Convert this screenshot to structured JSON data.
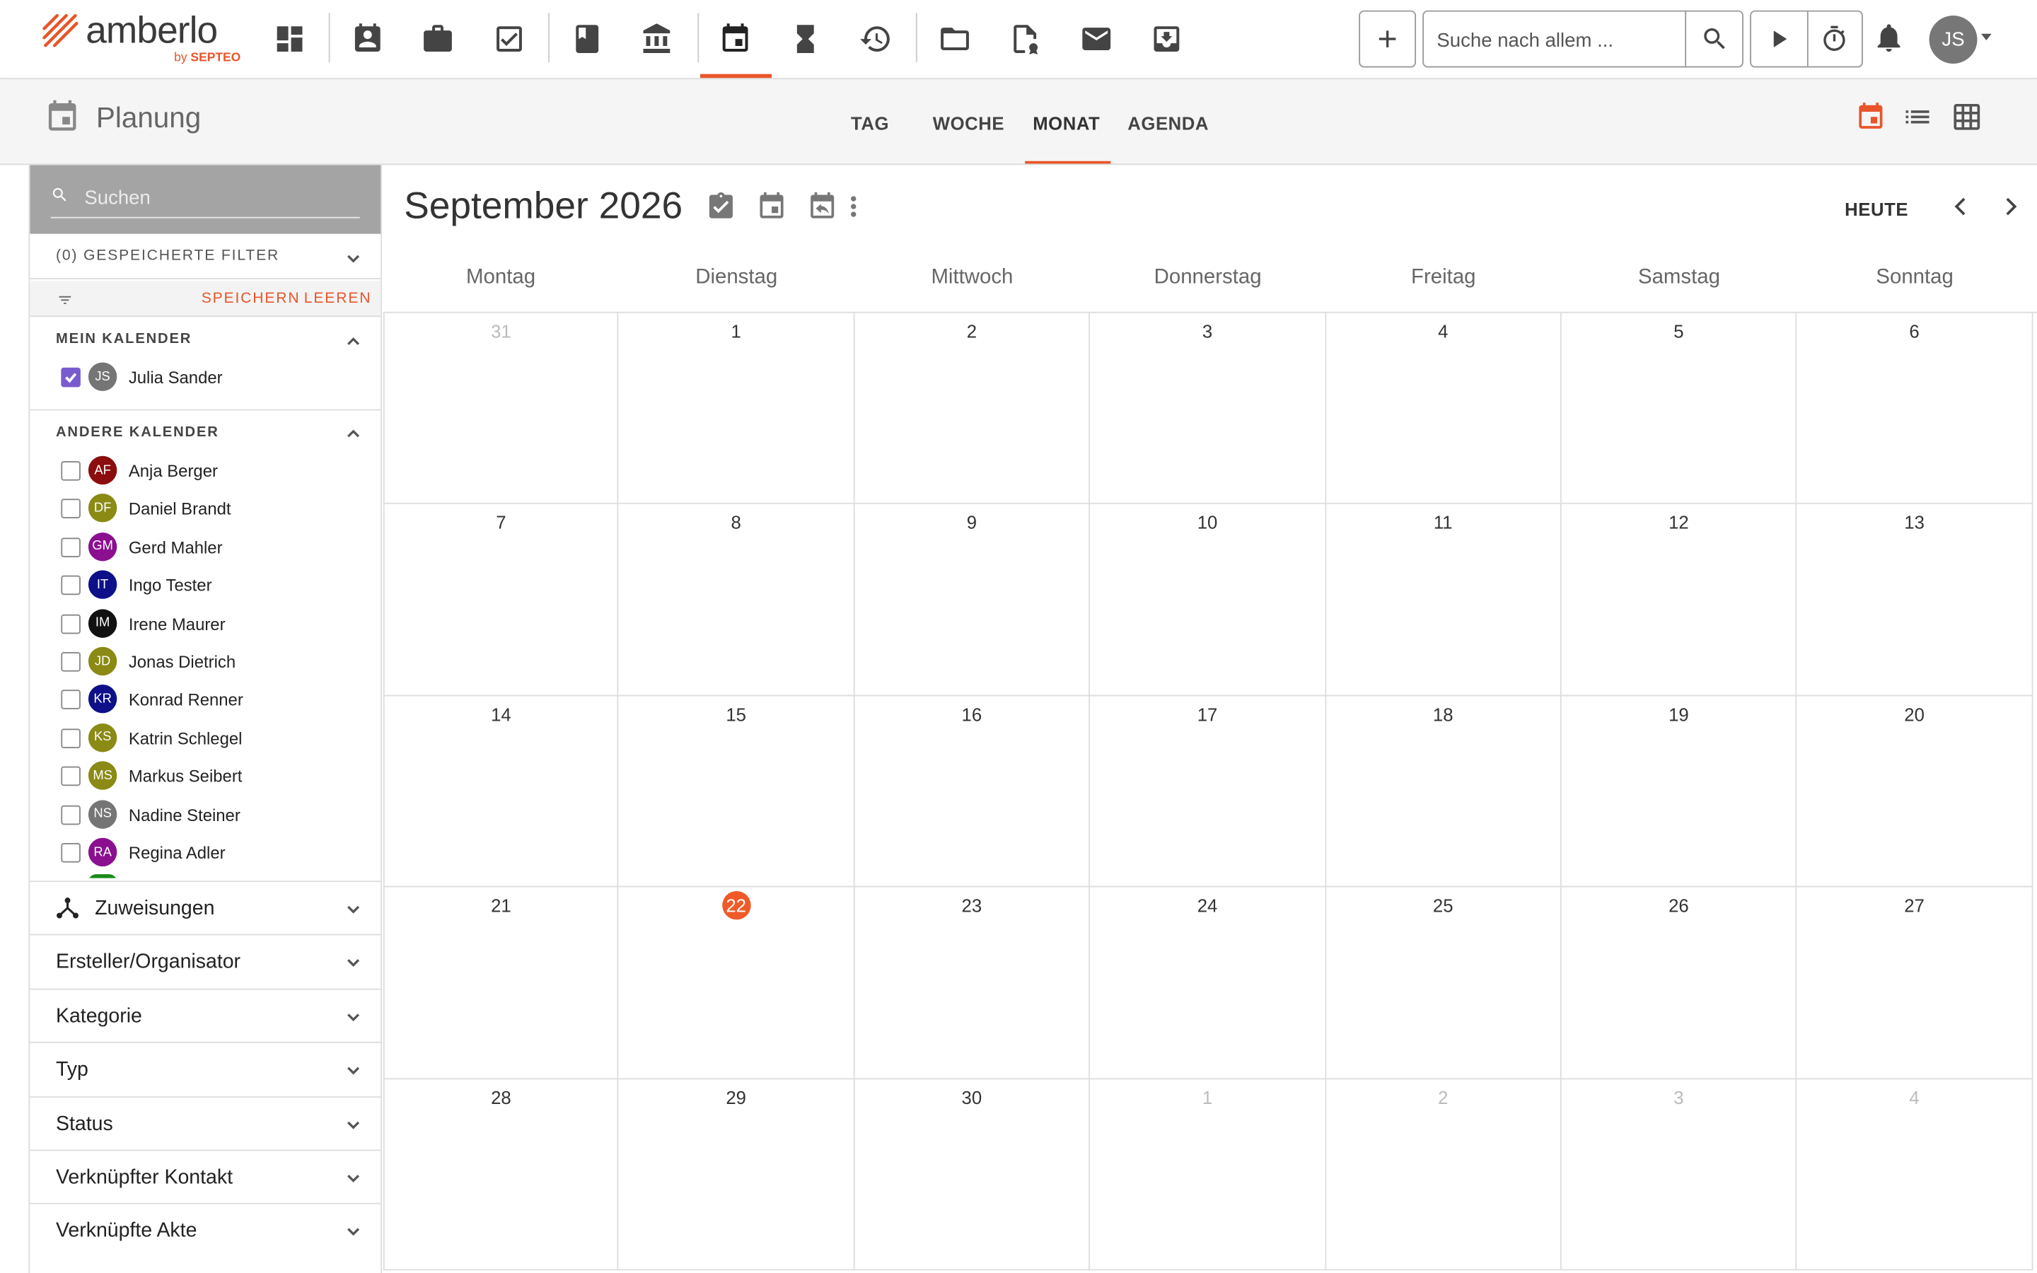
{
  "brand": {
    "name": "amberlo",
    "by_prefix": "by",
    "by_company": "SEPTEO"
  },
  "topnav": {
    "icons": [
      "dashboard-icon",
      "contacts-icon",
      "briefcase-icon",
      "tasks-icon",
      "book-icon",
      "bank-icon",
      "calendar-icon",
      "hourglass-icon",
      "billing-icon",
      "folder-icon",
      "certificate-icon",
      "mail-icon",
      "inbox-icon"
    ],
    "active": "calendar-icon",
    "search_placeholder": "Suche nach allem ...",
    "user_initials": "JS"
  },
  "page": {
    "title": "Planung",
    "view_tabs": [
      "TAG",
      "WOCHE",
      "MONAT",
      "AGENDA"
    ],
    "active_tab": "MONAT",
    "accent_color": "#e8552a"
  },
  "sidebar": {
    "search_placeholder": "Suchen",
    "saved_filters_label": "(0) GESPEICHERTE FILTER",
    "save_label": "SPEICHERN",
    "clear_label": "LEEREN",
    "my_calendar_label": "MEIN KALENDER",
    "my_calendar": [
      {
        "initials": "JS",
        "name": "Julia Sander",
        "color": "#757575",
        "checked": true
      }
    ],
    "other_calendars_label": "ANDERE KALENDER",
    "other_calendars": [
      {
        "initials": "AF",
        "name": "Anja Berger",
        "color": "#8b0d0d",
        "checked": false
      },
      {
        "initials": "DF",
        "name": "Daniel Brandt",
        "color": "#8a8a14",
        "checked": false
      },
      {
        "initials": "GM",
        "name": "Gerd Mahler",
        "color": "#8a1090",
        "checked": false
      },
      {
        "initials": "IT",
        "name": "Ingo Tester",
        "color": "#0d1088",
        "checked": false
      },
      {
        "initials": "IM",
        "name": "Irene Maurer",
        "color": "#111111",
        "checked": false
      },
      {
        "initials": "JD",
        "name": "Jonas Dietrich",
        "color": "#8a8a14",
        "checked": false
      },
      {
        "initials": "KR",
        "name": "Konrad Renner",
        "color": "#0d1088",
        "checked": false
      },
      {
        "initials": "KS",
        "name": "Katrin Schlegel",
        "color": "#8a8a14",
        "checked": false
      },
      {
        "initials": "MS",
        "name": "Markus Seibert",
        "color": "#8a8a14",
        "checked": false
      },
      {
        "initials": "NS",
        "name": "Nadine Steiner",
        "color": "#757575",
        "checked": false
      },
      {
        "initials": "RA",
        "name": "Regina Adler",
        "color": "#8a1090",
        "checked": false
      }
    ],
    "accordions": [
      {
        "label": "Zuweisungen",
        "icon": "hierarchy-icon"
      },
      {
        "label": "Ersteller/Organisator"
      },
      {
        "label": "Kategorie"
      },
      {
        "label": "Typ"
      },
      {
        "label": "Status"
      },
      {
        "label": "Verknüpfter Kontakt"
      },
      {
        "label": "Verknüpfte Akte"
      }
    ]
  },
  "calendar": {
    "month_title": "September 2026",
    "today_label": "HEUTE",
    "weekdays": [
      "Montag",
      "Dienstag",
      "Mittwoch",
      "Donnerstag",
      "Freitag",
      "Samstag",
      "Sonntag"
    ],
    "weeks": [
      [
        {
          "d": "31",
          "other": true
        },
        {
          "d": "1"
        },
        {
          "d": "2"
        },
        {
          "d": "3"
        },
        {
          "d": "4"
        },
        {
          "d": "5"
        },
        {
          "d": "6"
        }
      ],
      [
        {
          "d": "7"
        },
        {
          "d": "8"
        },
        {
          "d": "9"
        },
        {
          "d": "10"
        },
        {
          "d": "11"
        },
        {
          "d": "12"
        },
        {
          "d": "13"
        }
      ],
      [
        {
          "d": "14"
        },
        {
          "d": "15"
        },
        {
          "d": "16"
        },
        {
          "d": "17"
        },
        {
          "d": "18"
        },
        {
          "d": "19"
        },
        {
          "d": "20"
        }
      ],
      [
        {
          "d": "21"
        },
        {
          "d": "22",
          "today": true
        },
        {
          "d": "23"
        },
        {
          "d": "24"
        },
        {
          "d": "25"
        },
        {
          "d": "26"
        },
        {
          "d": "27"
        }
      ],
      [
        {
          "d": "28"
        },
        {
          "d": "29"
        },
        {
          "d": "30"
        },
        {
          "d": "1",
          "other": true
        },
        {
          "d": "2",
          "other": true
        },
        {
          "d": "3",
          "other": true
        },
        {
          "d": "4",
          "other": true
        }
      ]
    ]
  }
}
